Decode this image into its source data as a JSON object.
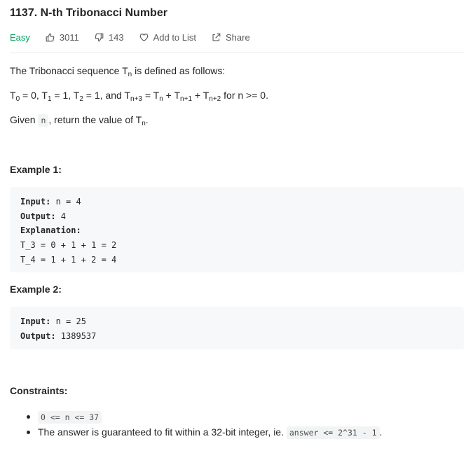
{
  "problem": {
    "title": "1137. N-th Tribonacci Number",
    "difficulty": "Easy",
    "likes": "3011",
    "dislikes": "143",
    "add_to_list_label": "Add to List",
    "share_label": "Share",
    "difficulty_color": "#00a35c"
  },
  "description": {
    "p1_text": "The Tribonacci sequence T",
    "p1_sub": "n",
    "p1_rest": " is defined as follows:",
    "p2": {
      "t0": "T",
      "t0_sub": "0",
      "t0_text": " = 0, T",
      "t1_sub": "1",
      "t1_text": " = 1, T",
      "t2_sub": "2",
      "t2_text": " = 1, and T",
      "tn3_sub": "n+3",
      "tn3_text": " = T",
      "tn_sub": "n",
      "tn_text": " + T",
      "tn1_sub": "n+1",
      "tn1_text": " + T",
      "tn2_sub": "n+2",
      "tail": " for n >= 0."
    },
    "p3_prefix": "Given ",
    "p3_code": "n",
    "p3_mid": ", return the value of T",
    "p3_sub": "n",
    "p3_end": "."
  },
  "examples": [
    {
      "heading": "Example 1:",
      "input_label": "Input:",
      "input_value": " n = 4",
      "output_label": "Output:",
      "output_value": " 4",
      "explanation_label": "Explanation:",
      "explanation_lines": [
        "T_3 = 0 + 1 + 1 = 2",
        "T_4 = 1 + 1 + 2 = 4"
      ]
    },
    {
      "heading": "Example 2:",
      "input_label": "Input:",
      "input_value": " n = 25",
      "output_label": "Output:",
      "output_value": " 1389537"
    }
  ],
  "constraints": {
    "heading": "Constraints:",
    "c1_code": "0 <= n <= 37",
    "c2_text": "The answer is guaranteed to fit within a 32-bit integer, ie. ",
    "c2_code": "answer <= 2^31 - 1",
    "c2_end": "."
  },
  "icons": {
    "like": "thumbs-up-icon",
    "dislike": "thumbs-down-icon",
    "add_to_list": "heart-icon",
    "share": "share-icon"
  }
}
